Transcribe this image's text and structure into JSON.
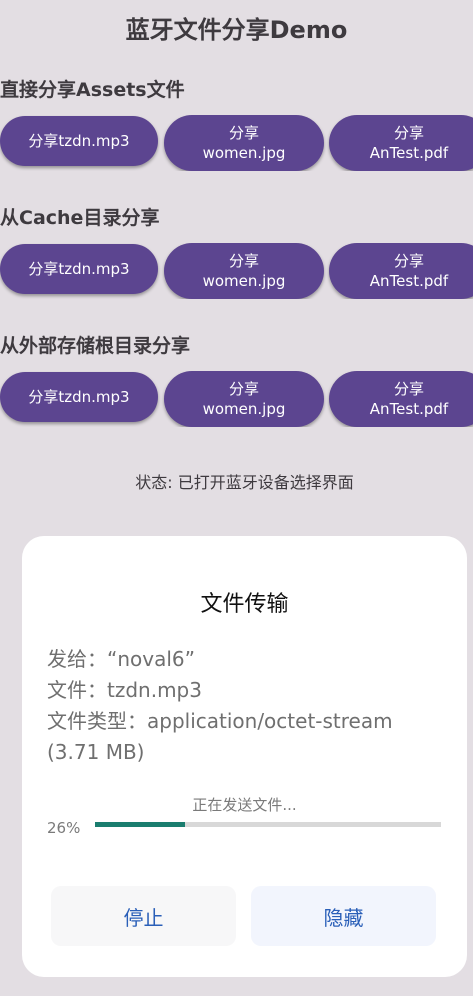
{
  "app": {
    "title": "蓝牙文件分享Demo"
  },
  "sections": [
    {
      "title": "直接分享Assets文件",
      "buttons": [
        {
          "line1": "分享tzdn.mp3",
          "line2": ""
        },
        {
          "line1": "分享",
          "line2": "women.jpg"
        },
        {
          "line1": "分享",
          "line2": "AnTest.pdf"
        }
      ]
    },
    {
      "title": "从Cache目录分享",
      "buttons": [
        {
          "line1": "分享tzdn.mp3",
          "line2": ""
        },
        {
          "line1": "分享",
          "line2": "women.jpg"
        },
        {
          "line1": "分享",
          "line2": "AnTest.pdf"
        }
      ]
    },
    {
      "title": "从外部存储根目录分享",
      "buttons": [
        {
          "line1": "分享tzdn.mp3",
          "line2": ""
        },
        {
          "line1": "分享",
          "line2": "women.jpg"
        },
        {
          "line1": "分享",
          "line2": "AnTest.pdf"
        }
      ]
    }
  ],
  "status": "状态: 已打开蓝牙设备选择界面",
  "dialog": {
    "title": "文件传输",
    "to": "发给：“noval6”",
    "file": "文件：tzdn.mp3",
    "type": "文件类型：application/octet-stream",
    "size": "(3.71 MB)",
    "progress_label": "正在发送文件...",
    "percent_text": "26%",
    "progress": 0.26,
    "stop_label": "停止",
    "hide_label": "隐藏"
  },
  "colors": {
    "background": "#e3dee3",
    "button": "#5c4590",
    "progress_fill": "#1a7d6f",
    "action_text": "#2a5fb8"
  }
}
